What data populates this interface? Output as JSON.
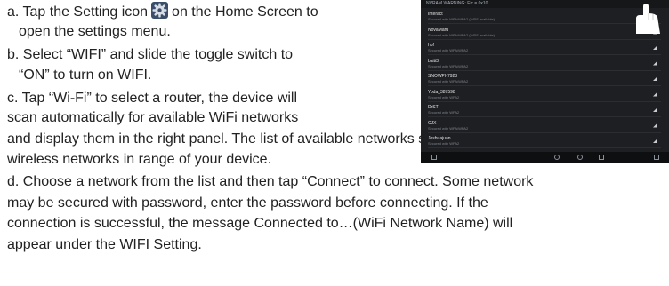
{
  "instructions": {
    "a_part1": "a. Tap the Setting icon",
    "a_part2": "on the Home Screen to",
    "a_line2": "open the settings menu.",
    "b_line1": "b. Select “WIFI” and slide the toggle switch to",
    "b_line2": "“ON” to turn on WIFI.",
    "c_line1": "c. Tap “Wi-Fi” to select a router, the device will",
    "c_line2": "scan automatically for available WiFi networks",
    "c_line3": "and display them in the right panel. The list of available networks shows all the",
    "c_line4": "wireless networks in range of your device.",
    "d_line1": "d. Choose a network from the list and then tap “Connect” to connect. Some network",
    "d_line2": "may be secured with password, enter the password before connecting. If the",
    "d_line3": "connection is successful, the message Connected to…(WiFi Network Name) will",
    "d_line4": "appear under the WIFI Setting."
  },
  "icons": {
    "setting": "gear-icon",
    "hand": "pointing-hand-icon",
    "signal": "wifi-signal-icon"
  },
  "screenshot": {
    "status_text": "NVRAM WARNING: Err = 0x10",
    "networks": [
      {
        "name": "Interact",
        "security": "Secured with WPA/WPA2 (WPS available)"
      },
      {
        "name": "NovaMaru",
        "security": "Secured with WPA/WPA2 (WPS available)"
      },
      {
        "name": "hbf",
        "security": "Secured with WPA/WPA2"
      },
      {
        "name": "baiti3",
        "security": "Secured with WPA/WPA2"
      },
      {
        "name": "SNOWPI-7923",
        "security": "Secured with WPA/WPA2"
      },
      {
        "name": "Yoda_387598",
        "security": "Secured with WPA2"
      },
      {
        "name": "DrST",
        "security": "Secured with WPA2"
      },
      {
        "name": "CJX",
        "security": "Secured with WPA/WPA2"
      },
      {
        "name": "Joshuajuan",
        "security": "Secured with WPA2"
      }
    ]
  }
}
